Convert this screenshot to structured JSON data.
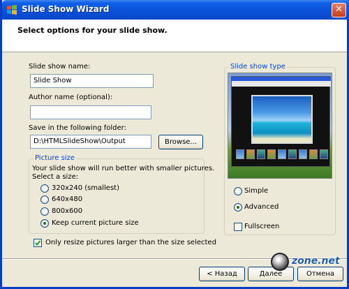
{
  "window": {
    "title": "Slide Show Wizard",
    "close_label": "✕"
  },
  "header": {
    "text": "Select options for your slide show."
  },
  "form": {
    "name_label": "Slide show name:",
    "name_value": "Slide Show",
    "author_label": "Author name (optional):",
    "author_value": "",
    "folder_label": "Save in the following folder:",
    "folder_value": "D:\\HTMLSlideShow\\Output",
    "browse_label": "Browse..."
  },
  "picture_size": {
    "title": "Picture size",
    "hint1": "Your slide show will run better with smaller pictures.",
    "hint2": "Select a size:",
    "options": [
      {
        "label": "320x240 (smallest)",
        "selected": false
      },
      {
        "label": "640x480",
        "selected": false
      },
      {
        "label": "800x600",
        "selected": false
      },
      {
        "label": "Keep current picture size",
        "selected": true
      }
    ]
  },
  "resize_checkbox": {
    "label": "Only resize pictures larger than the size selected",
    "checked": true
  },
  "slide_show_type": {
    "title": "Slide show type",
    "options": [
      {
        "label": "Simple",
        "selected": false
      },
      {
        "label": "Advanced",
        "selected": true
      }
    ],
    "fullscreen_label": "Fullscreen",
    "fullscreen_checked": false
  },
  "footer": {
    "back_label": "< Назад",
    "next_label": "Далее",
    "cancel_label": "Отмена"
  },
  "watermark": {
    "text": "zone.net"
  },
  "icons": {
    "title": "windows-logo-icon",
    "check": "checkmark-icon"
  },
  "colors": {
    "accent": "#0046d5",
    "titlebar": "#0a50d8",
    "window_bg": "#ece9d8"
  }
}
